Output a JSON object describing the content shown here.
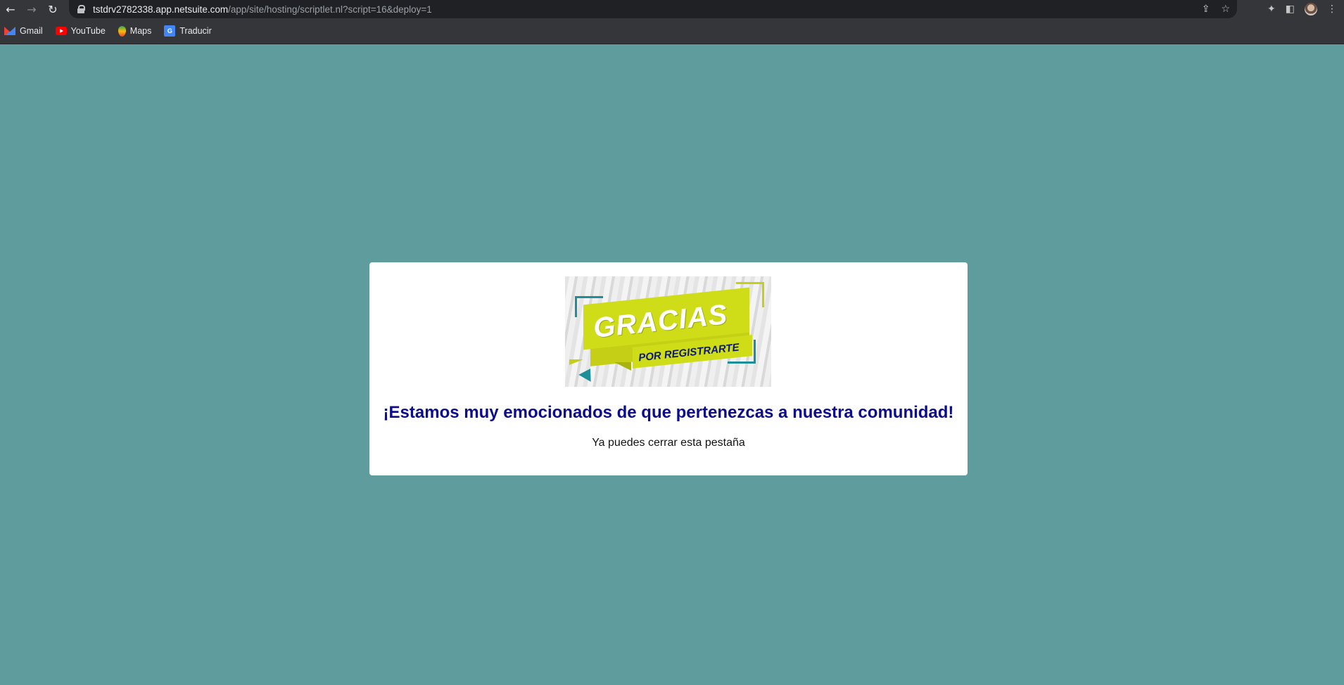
{
  "browser": {
    "url_host": "tstdrv2782338.app.netsuite.com",
    "url_path": "/app/site/hosting/scriptlet.nl?script=16&deploy=1",
    "bookmarks": [
      {
        "label": "Gmail",
        "icon": "gmail-icon"
      },
      {
        "label": "YouTube",
        "icon": "youtube-icon"
      },
      {
        "label": "Maps",
        "icon": "maps-icon"
      },
      {
        "label": "Traducir",
        "icon": "translate-icon"
      }
    ]
  },
  "page": {
    "background_color": "#5f9c9e",
    "banner": {
      "title": "GRACIAS",
      "subtitle": "POR REGISTRARTE"
    },
    "headline": "¡Estamos muy emocionados de que pertenezcas a nuestra comunidad!",
    "subtext": "Ya puedes cerrar esta pestaña"
  }
}
